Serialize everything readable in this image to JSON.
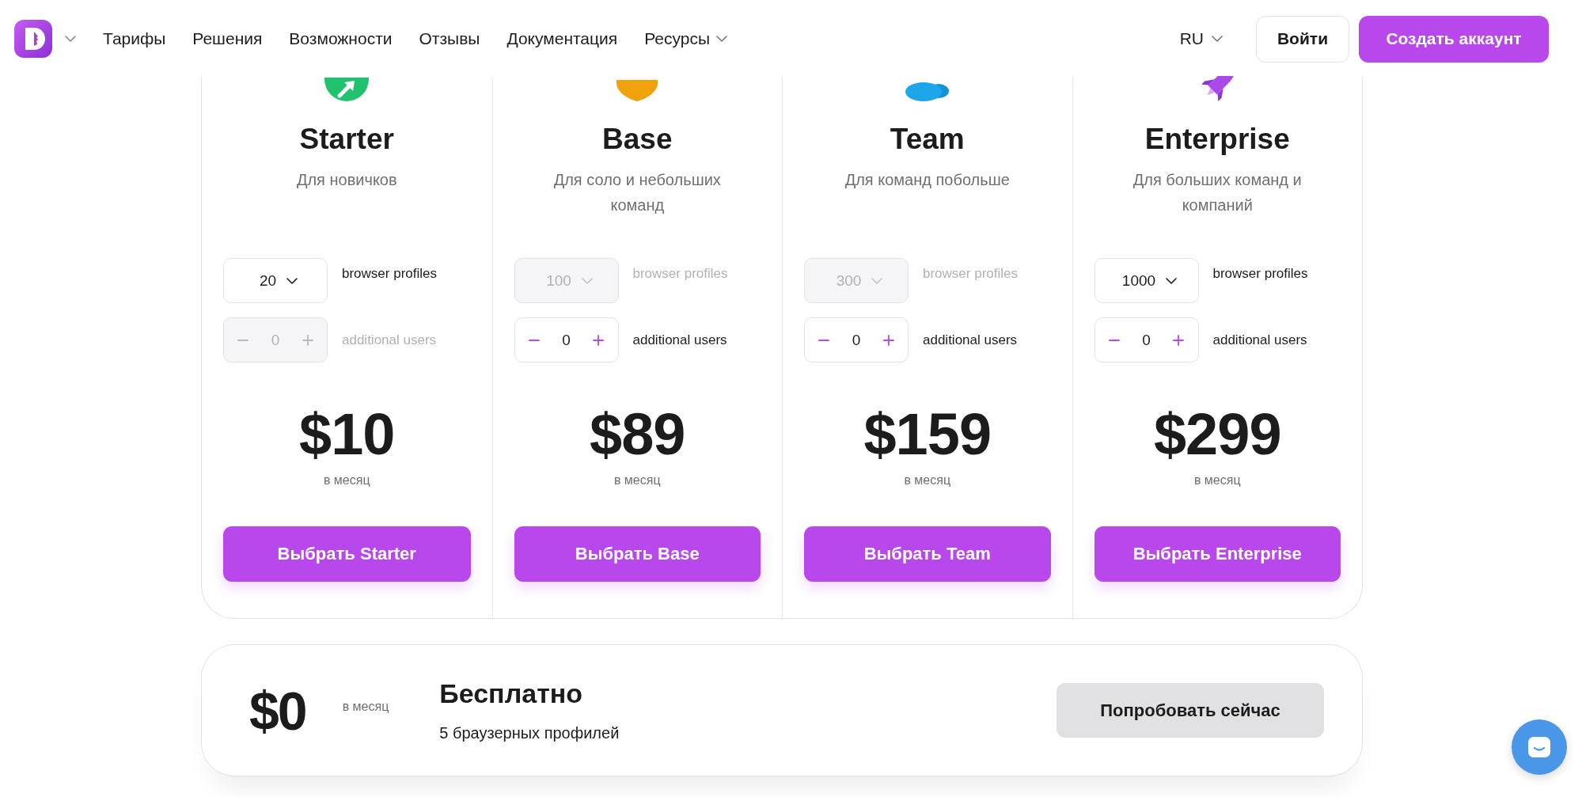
{
  "header": {
    "nav": [
      {
        "label": "Тарифы",
        "has_menu": false
      },
      {
        "label": "Решения",
        "has_menu": false
      },
      {
        "label": "Возможности",
        "has_menu": false
      },
      {
        "label": "Отзывы",
        "has_menu": false
      },
      {
        "label": "Документация",
        "has_menu": false
      },
      {
        "label": "Ресурсы",
        "has_menu": true
      }
    ],
    "language": "RU",
    "buttons": [
      {
        "label": "Войти",
        "kind": "outline"
      },
      {
        "label": "Создать аккаунт",
        "kind": "filled"
      }
    ]
  },
  "plans": [
    {
      "name": "Starter",
      "description": "Для новичков",
      "profiles": {
        "value": "20",
        "label": "browser profiles",
        "disabled": false
      },
      "users": {
        "value": "0",
        "label": "additional users",
        "disabled": true
      },
      "price": "$10",
      "period": "в месяц",
      "button": "Выбрать Starter"
    },
    {
      "name": "Base",
      "description": "Для соло и небольших команд",
      "profiles": {
        "value": "100",
        "label": "browser profiles",
        "disabled": true
      },
      "users": {
        "value": "0",
        "label": "additional users",
        "disabled": false
      },
      "price": "$89",
      "period": "в месяц",
      "button": "Выбрать Base"
    },
    {
      "name": "Team",
      "description": "Для команд побольше",
      "profiles": {
        "value": "300",
        "label": "browser profiles",
        "disabled": true
      },
      "users": {
        "value": "0",
        "label": "additional users",
        "disabled": false
      },
      "price": "$159",
      "period": "в месяц",
      "button": "Выбрать Team"
    },
    {
      "name": "Enterprise",
      "description": "Для больших команд и компаний",
      "profiles": {
        "value": "1000",
        "label": "browser profiles",
        "disabled": false
      },
      "users": {
        "value": "0",
        "label": "additional users",
        "disabled": false
      },
      "price": "$299",
      "period": "в месяц",
      "button": "Выбрать Enterprise"
    }
  ],
  "free_plan": {
    "price": "$0",
    "period": "в месяц",
    "title": "Бесплатно",
    "description": "5 браузерных профилей",
    "button": "Попробовать сейчас"
  }
}
